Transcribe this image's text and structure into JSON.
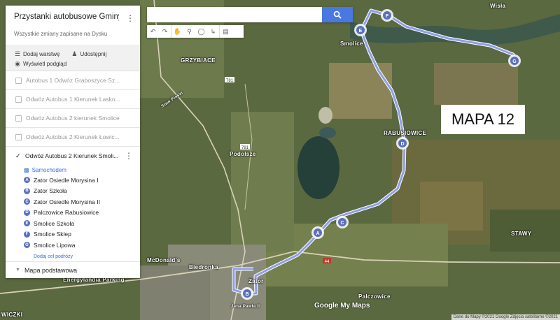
{
  "panel": {
    "title": "Przystanki autobusowe Gminy Za...",
    "saved_status": "Wszystkie zmiany zapisane na Dysku",
    "add_layer": "Dodaj warstwę",
    "share": "Udostępnij",
    "preview": "Wyświetl podgląd",
    "layers": [
      {
        "label": "Autobus 1 Odwóz Graboszyce Sz...",
        "checked": false
      },
      {
        "label": "Odwóz Autobus 1 Kierunek Lasko...",
        "checked": false
      },
      {
        "label": "Odwóz Autobus 2 kierunek Smolice",
        "checked": false
      },
      {
        "label": "Odwóz Autobus 2 Kierunek Łowic...",
        "checked": false
      }
    ],
    "active_layer": {
      "label": "Odwóz Autobus 2 Kierunek Smoli...",
      "mode": "Samochodem",
      "stops": [
        {
          "letter": "A",
          "name": "Zator Osiedle Morysina I"
        },
        {
          "letter": "B",
          "name": "Zator Szkoła"
        },
        {
          "letter": "C",
          "name": "Zator Osiedle Morysina II"
        },
        {
          "letter": "D",
          "name": "Palczowice Rabusiowice"
        },
        {
          "letter": "E",
          "name": "Smolice Szkoła"
        },
        {
          "letter": "F",
          "name": "Smolice Sklep"
        },
        {
          "letter": "G",
          "name": "Smolice Lipowa"
        }
      ],
      "add_destination": "Dodaj cel podróży"
    },
    "base_map": "Mapa podstawowa"
  },
  "search": {
    "placeholder": ""
  },
  "overlay": {
    "title": "MAPA 12"
  },
  "map_labels": {
    "grzybiace": "GRZYBIACE",
    "smolice": "Smolice",
    "rabusiowice": "RABUSIOWICE",
    "podolsze": "Podolsze",
    "stawy": "STAWY",
    "zator": "Zator",
    "palczowice": "Palczowice",
    "biedronka": "Biedronka",
    "mcdonalds": "McDonald's",
    "energylandia": "Energylandia Parking",
    "wisla": "Wisła",
    "rd781": "781",
    "rd44": "44",
    "lowiczki": "WICZKI",
    "jana_pawla": "Jana Pawła II",
    "staw": "Staw Piaski"
  },
  "marker_letters": [
    "A",
    "B",
    "C",
    "D",
    "E",
    "F",
    "G"
  ],
  "footer": {
    "logo": "Google My Maps",
    "credits": "Dane do Mapy ©2021 Google Zdjęcia satelitarne ©2021"
  },
  "colors": {
    "route": "#8f9fe8",
    "marker": "#5a6fc0",
    "search_button": "#4a78e2",
    "link": "#3b6ed8"
  }
}
